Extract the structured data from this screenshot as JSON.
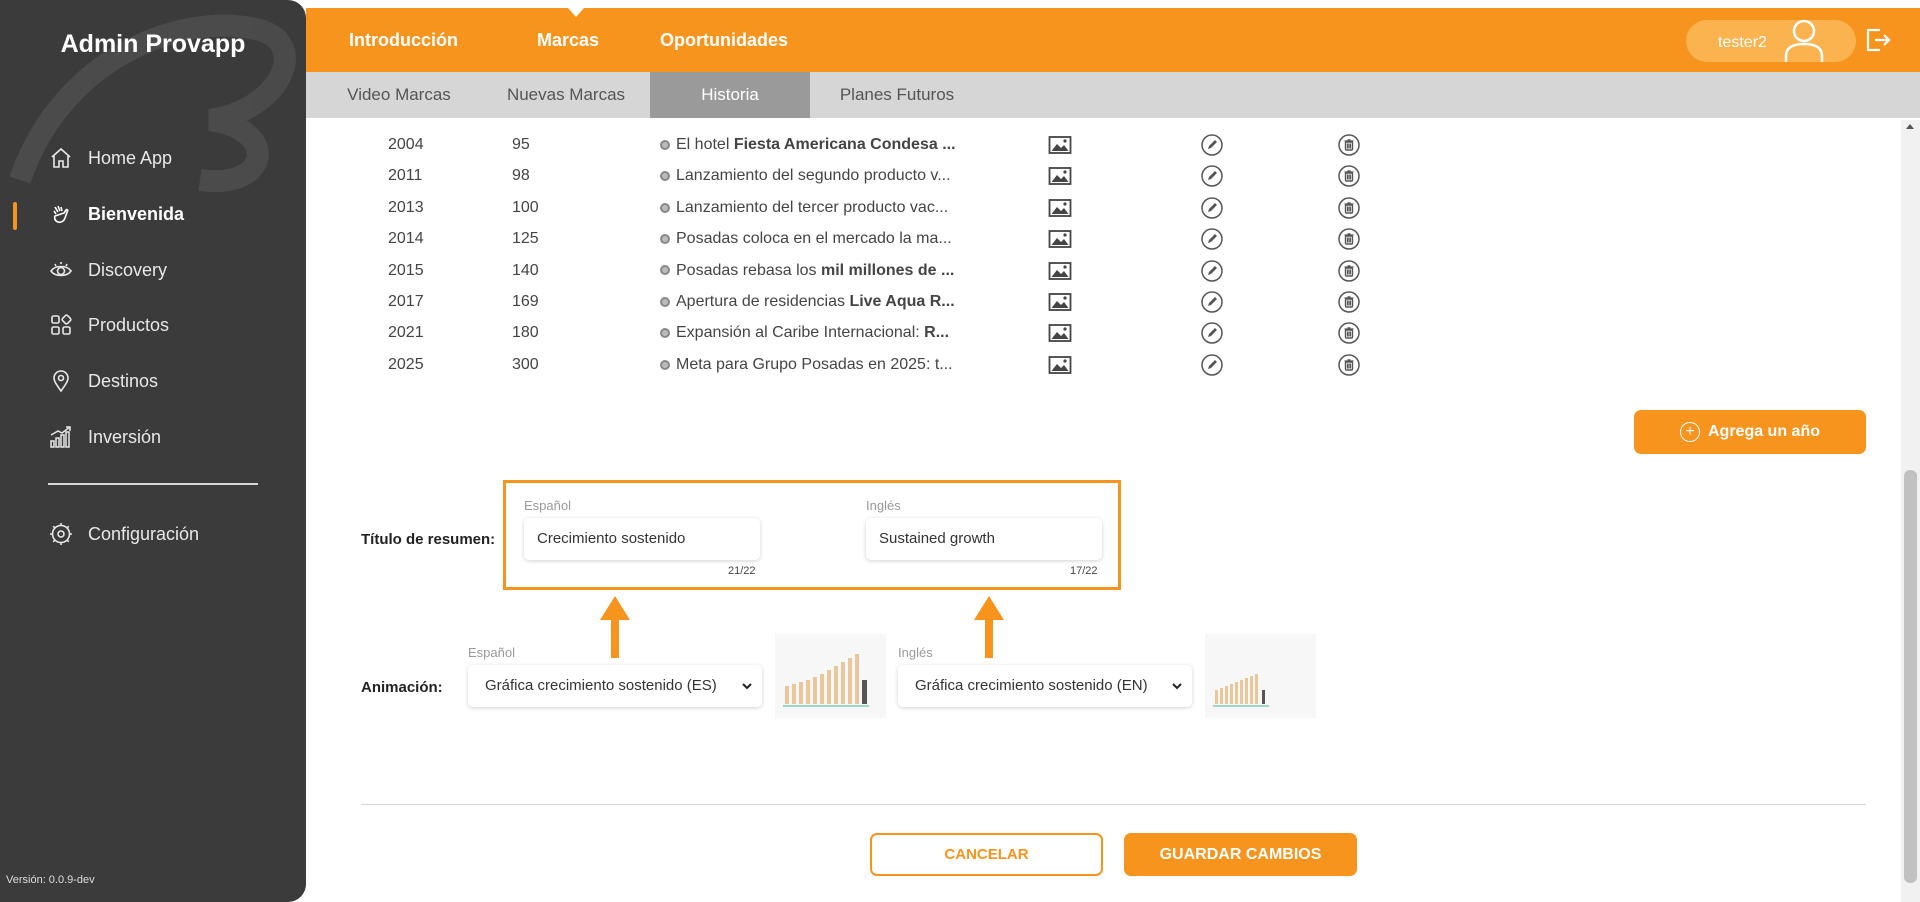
{
  "app": {
    "title": "Admin Provapp",
    "version": "Versión: 0.0.9-dev"
  },
  "sidebar": {
    "items": [
      {
        "label": "Home App",
        "icon": "home-icon"
      },
      {
        "label": "Bienvenida",
        "icon": "waving-hand-icon",
        "active": true
      },
      {
        "label": "Discovery",
        "icon": "eye-icon"
      },
      {
        "label": "Productos",
        "icon": "grid-icon"
      },
      {
        "label": "Destinos",
        "icon": "location-pin-icon"
      },
      {
        "label": "Inversión",
        "icon": "bar-chart-icon"
      }
    ],
    "settings": {
      "label": "Configuración",
      "icon": "gear-icon"
    }
  },
  "topnav": {
    "tabs": [
      "Introducción",
      "Marcas",
      "Oportunidades"
    ],
    "active_tab": "Marcas",
    "user": "tester2"
  },
  "subnav": {
    "tabs": [
      "Video Marcas",
      "Nuevas Marcas",
      "Historia",
      "Planes Futuros"
    ],
    "active_tab": "Historia"
  },
  "history_rows": [
    {
      "year": "2004",
      "value": "95",
      "desc_plain": "El hotel ",
      "desc_bold": "Fiesta Americana Condesa ..."
    },
    {
      "year": "2011",
      "value": "98",
      "desc_plain": "Lanzamiento del segundo producto v...",
      "desc_bold": ""
    },
    {
      "year": "2013",
      "value": "100",
      "desc_plain": "Lanzamiento del tercer producto vac...",
      "desc_bold": ""
    },
    {
      "year": "2014",
      "value": "125",
      "desc_plain": "Posadas coloca en el mercado la ma...",
      "desc_bold": ""
    },
    {
      "year": "2015",
      "value": "140",
      "desc_plain": "Posadas rebasa los ",
      "desc_bold": "mil millones de ..."
    },
    {
      "year": "2017",
      "value": "169",
      "desc_plain": "Apertura de residencias ",
      "desc_bold": "Live Aqua R..."
    },
    {
      "year": "2021",
      "value": "180",
      "desc_plain": "Expansión al Caribe Internacional: ",
      "desc_bold": "R..."
    },
    {
      "year": "2025",
      "value": "300",
      "desc_plain": "Meta para Grupo Posadas en 2025: t...",
      "desc_bold": ""
    }
  ],
  "add_year_label": "Agrega un año",
  "summary": {
    "label": "Título de resumen:",
    "es": {
      "label": "Español",
      "value": "Crecimiento sostenido",
      "counter": "21/22"
    },
    "en": {
      "label": "Inglés",
      "value": "Sustained growth",
      "counter": "17/22"
    }
  },
  "animation": {
    "label": "Animación:",
    "es": {
      "label": "Español",
      "selected": "Gráfica crecimiento sostenido (ES)"
    },
    "en": {
      "label": "Inglés",
      "selected": "Gráfica crecimiento sostenido (EN)"
    }
  },
  "buttons": {
    "cancel": "CANCELAR",
    "save": "GUARDAR CAMBIOS"
  },
  "colors": {
    "accent": "#f7941d",
    "sidebar": "#3b3b3b",
    "subbar": "#d6d6d6",
    "subtab_active": "#9a9a9a"
  }
}
